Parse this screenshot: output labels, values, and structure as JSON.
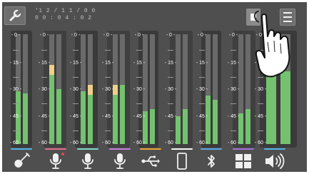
{
  "header": {
    "datetime_line1": "'1 2 / 1 1 / 0 0",
    "datetime_line2": "0 0 : 0 4 : 0 2"
  },
  "scale_labels": [
    "- 0 -",
    "- 15 -",
    "- 30 -",
    "- 45 -",
    "- 60 -"
  ],
  "channels": [
    {
      "name": "guitar",
      "icon": "guitar-icon",
      "color": "#4fb4e6",
      "levels": [
        0.48,
        0.46
      ],
      "peak": [
        false,
        false
      ]
    },
    {
      "name": "mic-1",
      "icon": "microphone-icon",
      "color": "#e86b8e",
      "levels": [
        0.72,
        0.5
      ],
      "peak": [
        true,
        false
      ],
      "indicator": true
    },
    {
      "name": "mic-2",
      "icon": "microphone-icon",
      "color": "#7fd3c3",
      "levels": [
        0.48,
        0.54
      ],
      "peak": [
        false,
        true
      ]
    },
    {
      "name": "mic-3",
      "icon": "microphone-icon",
      "color": "#c47fd8",
      "levels": [
        0.54,
        0.54
      ],
      "peak": [
        true,
        false
      ]
    },
    {
      "name": "usb",
      "icon": "usb-icon",
      "color": "#e9a63b",
      "levels": [
        0.3,
        0.32
      ],
      "peak": [
        false,
        false
      ]
    },
    {
      "name": "mobile",
      "icon": "mobile-icon",
      "color": "#f2f2f2",
      "levels": [
        0.25,
        0.32
      ],
      "peak": [
        false,
        false
      ]
    },
    {
      "name": "bluetooth",
      "icon": "bluetooth-icon",
      "color": "#5aa6e8",
      "levels": [
        0.44,
        0.4
      ],
      "peak": [
        false,
        false
      ]
    },
    {
      "name": "pads",
      "icon": "pads-icon",
      "color": "#a46ed8",
      "levels": [
        0.28,
        0.32
      ],
      "peak": [
        false,
        false
      ]
    },
    {
      "name": "master",
      "icon": "speaker-icon",
      "color": "#4fb4e6",
      "levels": [
        0.74,
        0.66
      ],
      "peak": [
        true,
        false
      ],
      "wide": true
    }
  ]
}
